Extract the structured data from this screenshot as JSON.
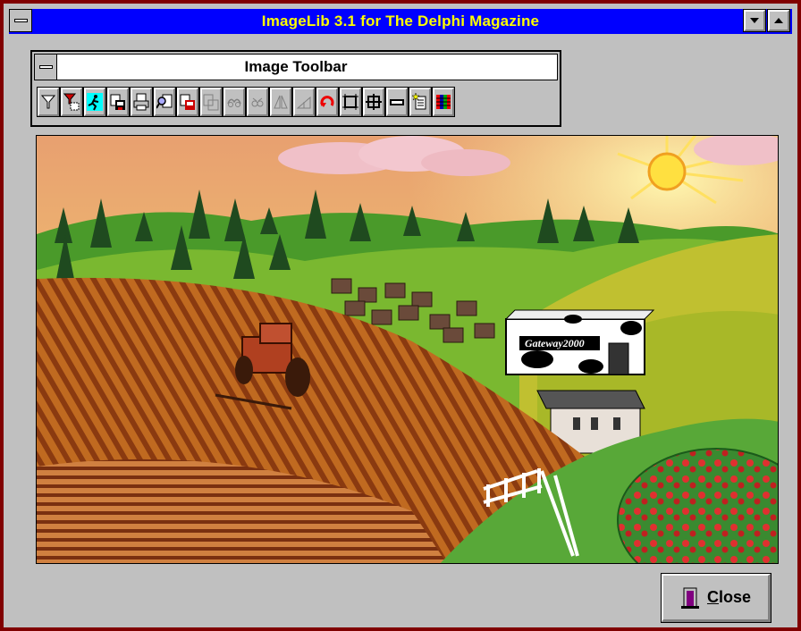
{
  "window": {
    "title": "ImageLib 3.1 for The Delphi  Magazine",
    "icons": {
      "system_menu": "system-menu-icon",
      "minimize": "minimize-arrow-icon",
      "maximize": "maximize-arrow-icon"
    }
  },
  "toolbar": {
    "title": "Image Toolbar",
    "tools": [
      {
        "icon": "filter-icon",
        "enabled": true
      },
      {
        "icon": "filter-select-icon",
        "enabled": true
      },
      {
        "icon": "runner-icon",
        "enabled": true
      },
      {
        "icon": "save-icon",
        "enabled": true
      },
      {
        "icon": "print-icon",
        "enabled": true
      },
      {
        "icon": "find-icon",
        "enabled": true
      },
      {
        "icon": "save-as-icon",
        "enabled": true
      },
      {
        "icon": "copy-disabled-icon",
        "enabled": false
      },
      {
        "icon": "link-disabled-icon",
        "enabled": false
      },
      {
        "icon": "link2-disabled-icon",
        "enabled": false
      },
      {
        "icon": "mirror-disabled-icon",
        "enabled": false
      },
      {
        "icon": "flip-disabled-icon",
        "enabled": false
      },
      {
        "icon": "rotate-icon",
        "enabled": true
      },
      {
        "icon": "crop-icon",
        "enabled": true
      },
      {
        "icon": "grid-icon",
        "enabled": true
      },
      {
        "icon": "gif-icon",
        "enabled": true
      },
      {
        "icon": "new-page-icon",
        "enabled": true
      },
      {
        "icon": "color-bars-icon",
        "enabled": true
      }
    ]
  },
  "image": {
    "sign_text": "Gateway2000"
  },
  "close_button": {
    "underlined_letter": "C",
    "rest_of_label": "lose",
    "icon": "door-exit-icon"
  },
  "colors": {
    "titlebar": "#0000ff",
    "title_text": "#ffff00",
    "window_border": "#800000",
    "face": "#c0c0c0"
  }
}
